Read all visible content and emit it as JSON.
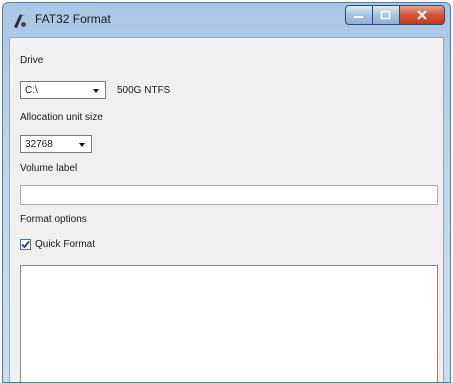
{
  "window": {
    "title": "FAT32 Format"
  },
  "drive": {
    "label": "Drive",
    "selected": "C:\\",
    "info": "500G NTFS"
  },
  "allocation": {
    "label": "Allocation unit size",
    "selected": "32768"
  },
  "volume": {
    "label": "Volume label",
    "value": ""
  },
  "format_options": {
    "label": "Format options",
    "quick_format_label": "Quick Format",
    "quick_format_checked": true
  },
  "log": {
    "text": ""
  },
  "colors": {
    "title_bar": "#bcd5ee",
    "client_bg": "#f0f0f0",
    "close_button": "#c7432b"
  },
  "icons": [
    "app-icon",
    "minimize-icon",
    "maximize-icon",
    "close-icon",
    "chevron-down-icon",
    "checkmark-icon"
  ]
}
